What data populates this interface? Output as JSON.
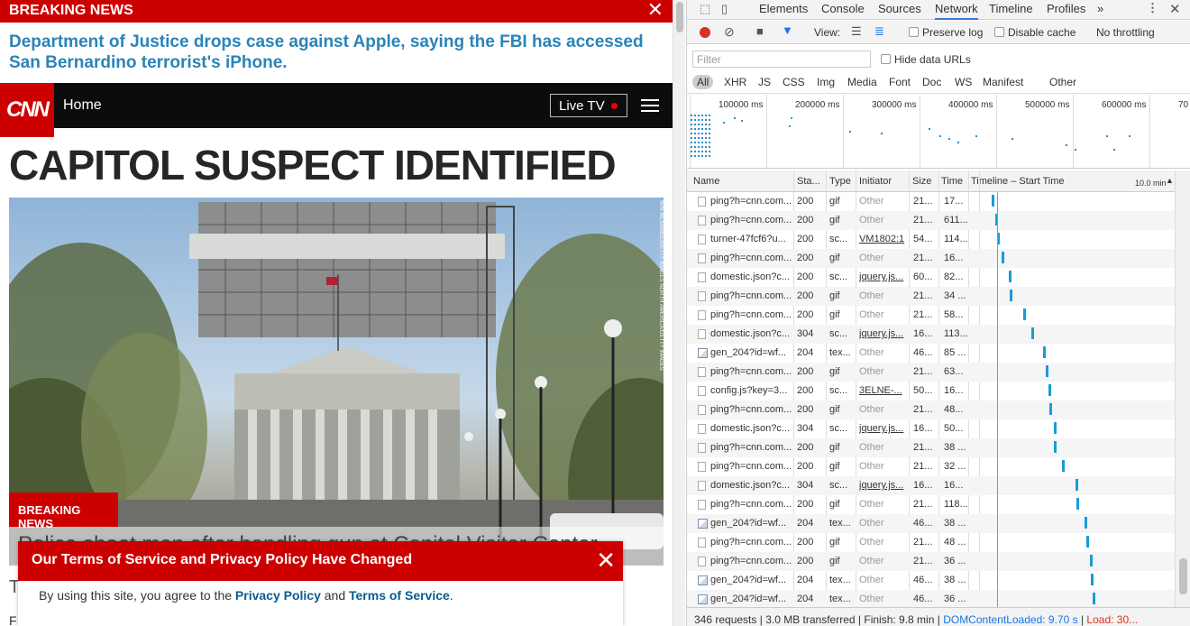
{
  "left": {
    "breaking_bar": {
      "label": "BREAKING NEWS",
      "close": "✕"
    },
    "breaking_headline": "Department of Justice drops case against Apple, saying the FBI has accessed San Bernardino terrorist's iPhone.",
    "nav": {
      "logo": "CNN",
      "home": "Home",
      "live_tv": "Live TV"
    },
    "headline": "CAPITOL SUSPECT IDENTIFIED",
    "photo_credit": "WIN MCNAMEE/GETTY IMAGES NORTH AMERICA/GETTY IMAGES",
    "breaking_tag": "BREAKING NEWS",
    "caption": "Police shoot man after handling gun at Capitol Visitor Center",
    "tos": {
      "title": "Our Terms of Service and Privacy Policy Have Changed",
      "close": "✕",
      "text_before": "By using this site, you agree to the ",
      "privacy_link": "Privacy Policy",
      "text_mid": " and ",
      "terms_link": "Terms of Service",
      "text_after": "."
    },
    "below_t": "T",
    "below_f": "F"
  },
  "devtools": {
    "tabs": [
      "Elements",
      "Console",
      "Sources",
      "Network",
      "Timeline",
      "Profiles"
    ],
    "active_tab": "Network",
    "more": "»",
    "toolbar": {
      "view": "View:",
      "preserve_log": "Preserve log",
      "disable_cache": "Disable cache",
      "throttling": "No throttling"
    },
    "filter_placeholder": "Filter",
    "hide_data_urls": "Hide data URLs",
    "types": [
      "All",
      "XHR",
      "JS",
      "CSS",
      "Img",
      "Media",
      "Font",
      "Doc",
      "WS",
      "Manifest",
      "Other"
    ],
    "overview_ticks": [
      "100000 ms",
      "200000 ms",
      "300000 ms",
      "400000 ms",
      "500000 ms",
      "600000 ms",
      "70"
    ],
    "columns": {
      "name": "Name",
      "status": "Sta...",
      "type": "Type",
      "initiator": "Initiator",
      "size": "Size",
      "time": "Time",
      "timeline": "Timeline – Start Time",
      "scale": "10.0 min"
    },
    "rows": [
      {
        "name": "ping?h=cnn.com...",
        "status": "200",
        "type": "gif",
        "initiator": "Other",
        "size": "21...",
        "time": "17...",
        "icon": "file",
        "bar": 0.065
      },
      {
        "name": "ping?h=cnn.com...",
        "status": "200",
        "type": "gif",
        "initiator": "Other",
        "size": "21...",
        "time": "611...",
        "icon": "file",
        "bar": 0.085
      },
      {
        "name": "turner-47fcf6?u...",
        "status": "200",
        "type": "sc...",
        "initiator": "VM1802:1",
        "size": "54...",
        "time": "114...",
        "icon": "file",
        "bar": 0.093,
        "link": true
      },
      {
        "name": "ping?h=cnn.com...",
        "status": "200",
        "type": "gif",
        "initiator": "Other",
        "size": "21...",
        "time": "16...",
        "icon": "file",
        "bar": 0.12
      },
      {
        "name": "domestic.json?c...",
        "status": "200",
        "type": "sc...",
        "initiator": "jquery.js...",
        "size": "60...",
        "time": "82...",
        "icon": "file",
        "bar": 0.155,
        "link": true
      },
      {
        "name": "ping?h=cnn.com...",
        "status": "200",
        "type": "gif",
        "initiator": "Other",
        "size": "21...",
        "time": "34 ...",
        "icon": "file",
        "bar": 0.16
      },
      {
        "name": "ping?h=cnn.com...",
        "status": "200",
        "type": "gif",
        "initiator": "Other",
        "size": "21...",
        "time": "58...",
        "icon": "file",
        "bar": 0.235
      },
      {
        "name": "domestic.json?c...",
        "status": "304",
        "type": "sc...",
        "initiator": "jquery.js...",
        "size": "16...",
        "time": "113...",
        "icon": "file",
        "bar": 0.275,
        "link": true
      },
      {
        "name": "gen_204?id=wf...",
        "status": "204",
        "type": "tex...",
        "initiator": "Other",
        "size": "46...",
        "time": "85 ...",
        "icon": "img",
        "bar": 0.34
      },
      {
        "name": "ping?h=cnn.com...",
        "status": "200",
        "type": "gif",
        "initiator": "Other",
        "size": "21...",
        "time": "63...",
        "icon": "file",
        "bar": 0.35
      },
      {
        "name": "config.js?key=3...",
        "status": "200",
        "type": "sc...",
        "initiator": "3ELNE-...",
        "size": "50...",
        "time": "16...",
        "icon": "file",
        "bar": 0.365,
        "link": true
      },
      {
        "name": "ping?h=cnn.com...",
        "status": "200",
        "type": "gif",
        "initiator": "Other",
        "size": "21...",
        "time": "48...",
        "icon": "file",
        "bar": 0.37
      },
      {
        "name": "domestic.json?c...",
        "status": "304",
        "type": "sc...",
        "initiator": "jquery.js...",
        "size": "16...",
        "time": "50...",
        "icon": "file",
        "bar": 0.395,
        "link": true
      },
      {
        "name": "ping?h=cnn.com...",
        "status": "200",
        "type": "gif",
        "initiator": "Other",
        "size": "21...",
        "time": "38 ...",
        "icon": "file",
        "bar": 0.395
      },
      {
        "name": "ping?h=cnn.com...",
        "status": "200",
        "type": "gif",
        "initiator": "Other",
        "size": "21...",
        "time": "32 ...",
        "icon": "file",
        "bar": 0.44
      },
      {
        "name": "domestic.json?c...",
        "status": "304",
        "type": "sc...",
        "initiator": "jquery.js...",
        "size": "16...",
        "time": "16...",
        "icon": "file",
        "bar": 0.51,
        "link": true
      },
      {
        "name": "ping?h=cnn.com...",
        "status": "200",
        "type": "gif",
        "initiator": "Other",
        "size": "21...",
        "time": "118...",
        "icon": "file",
        "bar": 0.513
      },
      {
        "name": "gen_204?id=wf...",
        "status": "204",
        "type": "tex...",
        "initiator": "Other",
        "size": "46...",
        "time": "38 ...",
        "icon": "img",
        "bar": 0.555
      },
      {
        "name": "ping?h=cnn.com...",
        "status": "200",
        "type": "gif",
        "initiator": "Other",
        "size": "21...",
        "time": "48 ...",
        "icon": "file",
        "bar": 0.565
      },
      {
        "name": "ping?h=cnn.com...",
        "status": "200",
        "type": "gif",
        "initiator": "Other",
        "size": "21...",
        "time": "36 ...",
        "icon": "file",
        "bar": 0.585
      },
      {
        "name": "gen_204?id=wf...",
        "status": "204",
        "type": "tex...",
        "initiator": "Other",
        "size": "46...",
        "time": "38 ...",
        "icon": "img",
        "bar": 0.59
      },
      {
        "name": "gen_204?id=wf...",
        "status": "204",
        "type": "tex...",
        "initiator": "Other",
        "size": "46...",
        "time": "36 ...",
        "icon": "img",
        "bar": 0.6
      }
    ],
    "status": {
      "requests": "346 requests",
      "transferred": "3.0 MB transferred",
      "finish": "Finish: 9.8 min",
      "dcl": "DOMContentLoaded: 9.70 s",
      "load": "Load: 30..."
    }
  }
}
